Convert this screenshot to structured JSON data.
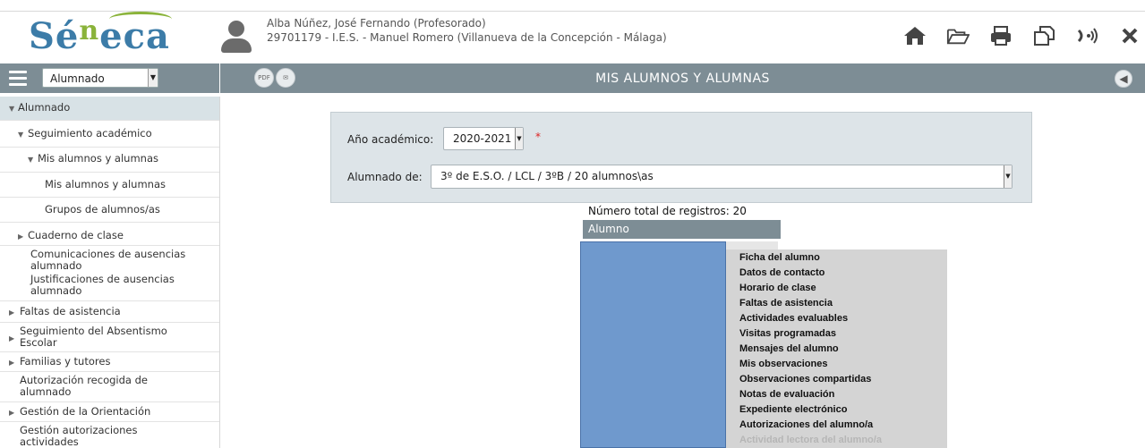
{
  "header": {
    "logo_text_a": "Sé",
    "logo_text_b": "n",
    "logo_text_c": "eca",
    "user_name": "Alba Núñez, José Fernando (Profesorado)",
    "user_center": "29701179 - I.E.S. - Manuel Romero (Villanueva de la Concepción - Málaga)",
    "icons": [
      "home-icon",
      "folder-icon",
      "print-icon",
      "copy-icon",
      "sound-icon",
      "close-icon"
    ]
  },
  "sidebar": {
    "module_value": "Alumnado",
    "items": [
      {
        "label": "Alumnado",
        "marker": "▼"
      },
      {
        "label": "Seguimiento académico",
        "marker": "▼"
      },
      {
        "label": "Mis alumnos y alumnas",
        "marker": "▼"
      },
      {
        "label": "Mis alumnos y alumnas",
        "marker": ""
      },
      {
        "label": "Grupos de alumnos/as",
        "marker": ""
      },
      {
        "label": "Cuaderno de clase",
        "marker": "▶"
      },
      {
        "label": "Comunicaciones de ausencias alumnado",
        "marker": ""
      },
      {
        "label": "Justificaciones de ausencias alumnado",
        "marker": ""
      },
      {
        "label": "Faltas de asistencia",
        "marker": "▶"
      },
      {
        "label": "Seguimiento del Absentismo Escolar",
        "marker": "▶"
      },
      {
        "label": "Familias y tutores",
        "marker": "▶"
      },
      {
        "label": "Autorización recogida de alumnado",
        "marker": ""
      },
      {
        "label": "Gestión de la Orientación",
        "marker": "▶"
      },
      {
        "label": "Gestión autorizaciones actividades",
        "marker": ""
      }
    ]
  },
  "main": {
    "title": "MIS ALUMNOS Y ALUMNAS",
    "toolbar_icons": [
      "pdf-xls-icon",
      "mail-icon"
    ],
    "filter": {
      "year_label": "Año académico:",
      "year_value": "2020-2021",
      "required_mark": "*",
      "group_label": "Alumnado de:",
      "group_value": "3º de E.S.O. / LCL / 3ºB / 20 alumnos\\as"
    },
    "total_records": "Número total de registros: 20",
    "table_header": "Alumno",
    "context_menu": [
      {
        "label": "Ficha del alumno",
        "enabled": true
      },
      {
        "label": "Datos de contacto",
        "enabled": true
      },
      {
        "label": "Horario de clase",
        "enabled": true
      },
      {
        "label": "Faltas de asistencia",
        "enabled": true
      },
      {
        "label": "Actividades evaluables",
        "enabled": true
      },
      {
        "label": "Visitas programadas",
        "enabled": true
      },
      {
        "label": "Mensajes del alumno",
        "enabled": true
      },
      {
        "label": "Mis observaciones",
        "enabled": true
      },
      {
        "label": "Observaciones compartidas",
        "enabled": true
      },
      {
        "label": "Notas de evaluación",
        "enabled": true
      },
      {
        "label": "Expediente electrónico",
        "enabled": true
      },
      {
        "label": "Autorizaciones del alumno/a",
        "enabled": true
      },
      {
        "label": "Actividad lectora del alumno/a",
        "enabled": false
      }
    ]
  },
  "colors": {
    "bar": "#7d8d95",
    "logo_blue": "#3c7ca8",
    "logo_green": "#8ab33a",
    "redaction": "#6f99cd",
    "menu_bg": "#d4d4d4"
  }
}
